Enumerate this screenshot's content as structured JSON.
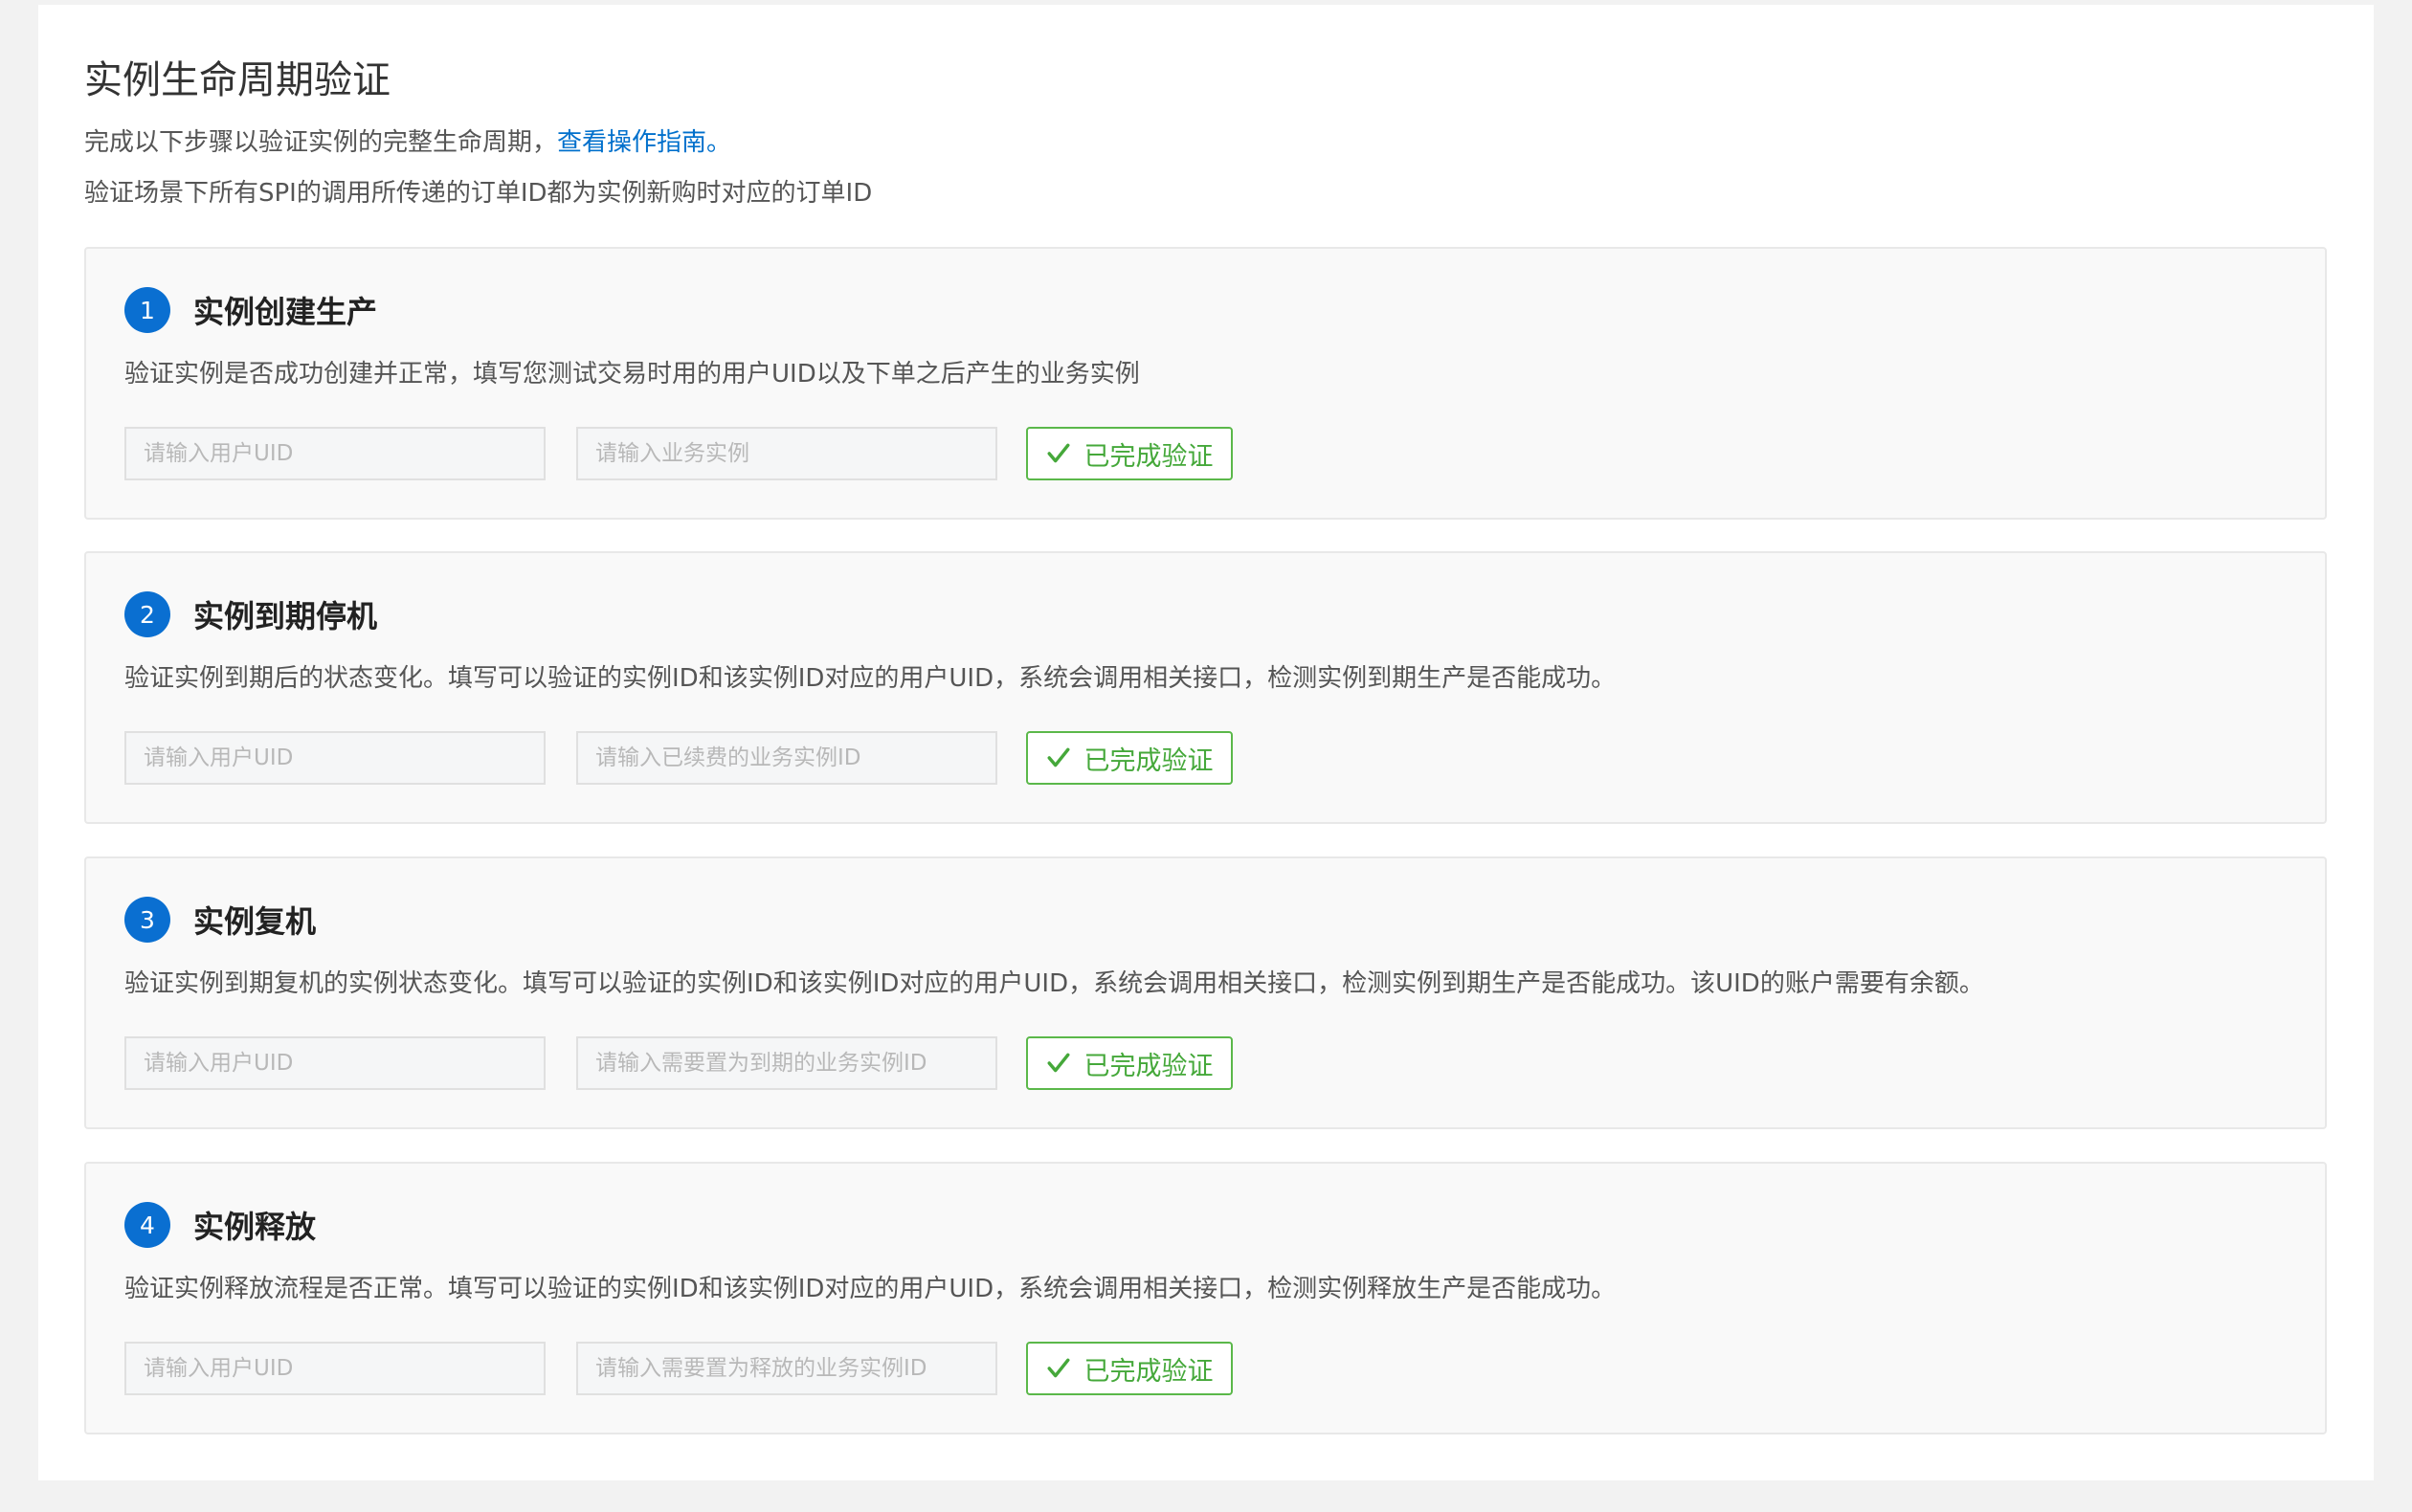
{
  "header": {
    "title": "实例生命周期验证",
    "intro_text": "完成以下步骤以验证实例的完整生命周期，",
    "guide_link": "查看操作指南。",
    "note": "验证场景下所有SPI的调用所传递的订单ID都为实例新购时对应的订单ID"
  },
  "steps": [
    {
      "number": "1",
      "title": "实例创建生产",
      "description": "验证实例是否成功创建并正常，填写您测试交易时用的用户UID以及下单之后产生的业务实例",
      "uid_placeholder": "请输入用户UID",
      "instance_placeholder": "请输入业务实例",
      "verify_label": "已完成验证"
    },
    {
      "number": "2",
      "title": "实例到期停机",
      "description": "验证实例到期后的状态变化。填写可以验证的实例ID和该实例ID对应的用户UID，系统会调用相关接口，检测实例到期生产是否能成功。",
      "uid_placeholder": "请输入用户UID",
      "instance_placeholder": "请输入已续费的业务实例ID",
      "verify_label": "已完成验证"
    },
    {
      "number": "3",
      "title": "实例复机",
      "description": "验证实例到期复机的实例状态变化。填写可以验证的实例ID和该实例ID对应的用户UID，系统会调用相关接口，检测实例到期生产是否能成功。该UID的账户需要有余额。",
      "uid_placeholder": "请输入用户UID",
      "instance_placeholder": "请输入需要置为到期的业务实例ID",
      "verify_label": "已完成验证"
    },
    {
      "number": "4",
      "title": "实例释放",
      "description": "验证实例释放流程是否正常。填写可以验证的实例ID和该实例ID对应的用户UID，系统会调用相关接口，检测实例释放生产是否能成功。",
      "uid_placeholder": "请输入用户UID",
      "instance_placeholder": "请输入需要置为释放的业务实例ID",
      "verify_label": "已完成验证"
    }
  ],
  "icons": {
    "verify_button": "check-icon"
  },
  "colors": {
    "accent": "#0a6fd1",
    "link": "#0070cc",
    "success": "#45a83a",
    "success_border": "#5bb84a"
  }
}
